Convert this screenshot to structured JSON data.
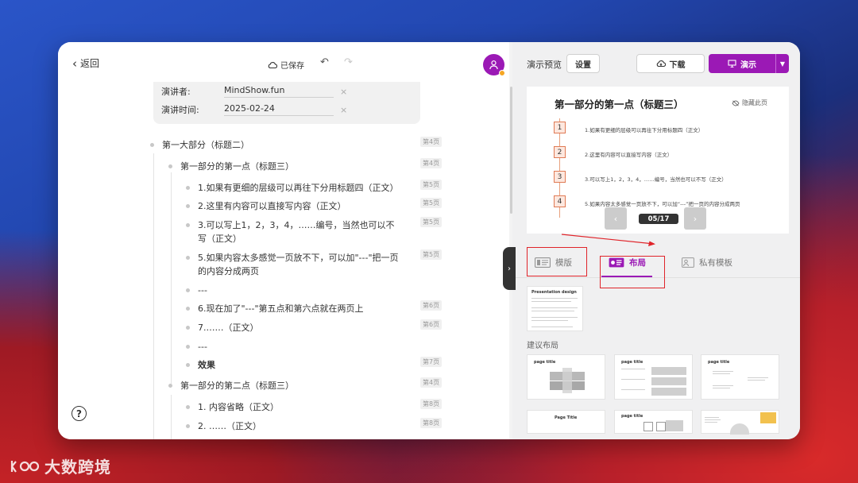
{
  "editor": {
    "back_label": "返回",
    "saved_label": "已保存",
    "meta": [
      {
        "label": "演讲者:",
        "value": "MindShow.fun"
      },
      {
        "label": "演讲时间:",
        "value": "2025-02-24"
      }
    ],
    "outline": [
      {
        "text": "第一大部分（标题二）",
        "page": "第4页"
      },
      {
        "text": "第一部分的第一点（标题三）",
        "page": "第4页"
      },
      {
        "text": "1.如果有更细的层级可以再往下分用标题四（正文）",
        "page": "第5页"
      },
      {
        "text": "2.这里有内容可以直接写内容（正文）",
        "page": "第5页"
      },
      {
        "text": "3.可以写上1，2，3，4，……编号，当然也可以不",
        "text2": "写（正文）",
        "page": "第5页"
      },
      {
        "text": "5.如果内容太多感觉一页放不下，可以加\"---\"把一页",
        "text2": "的内容分成两页",
        "page": "第5页"
      },
      {
        "text": "---"
      },
      {
        "text": "6.现在加了\"---\"第五点和第六点就在两页上",
        "page": "第6页"
      },
      {
        "text": "7.……（正文）",
        "page": "第6页"
      },
      {
        "text": "---"
      },
      {
        "text": "效果",
        "page": "第7页"
      },
      {
        "text": "第一部分的第二点（标题三）",
        "page": "第4页"
      },
      {
        "text": "1. 内容省略（正文）",
        "page": "第8页"
      },
      {
        "text": "2. ……（正文）",
        "page": "第8页"
      }
    ],
    "help_label": "?"
  },
  "preview": {
    "title": "演示预览",
    "settings_label": "设置",
    "download_label": "下载",
    "present_label": "演示",
    "slide": {
      "title": "第一部分的第一点（标题三）",
      "hide_label": "隐藏此页",
      "items": [
        {
          "num": "1",
          "text": "1.如果有更细的层级可以再往下分用标题四（正文）"
        },
        {
          "num": "2",
          "text": "2.这里有内容可以直接写内容（正文）"
        },
        {
          "num": "3",
          "text": "3.可以写上1，2，3，4，……编号，当然也可以不写（正文）"
        },
        {
          "num": "4",
          "text": "5.如果内容太多感觉一页放不下，可以加“---”把一页的内容分成两页"
        }
      ],
      "page_indicator": "05/17"
    },
    "tabs": [
      {
        "label": "模版"
      },
      {
        "label": "布局",
        "active": true
      },
      {
        "label": "私有模板"
      }
    ],
    "current_layout": {
      "title": "Presentation design"
    },
    "suggest_label": "建议布局",
    "layout_titles": [
      "page title",
      "page title",
      "page title",
      "Page Title",
      "page title"
    ],
    "accent_color": "#9b19b5",
    "highlight_color": "#e0242a"
  },
  "watermark": "大数跨境"
}
